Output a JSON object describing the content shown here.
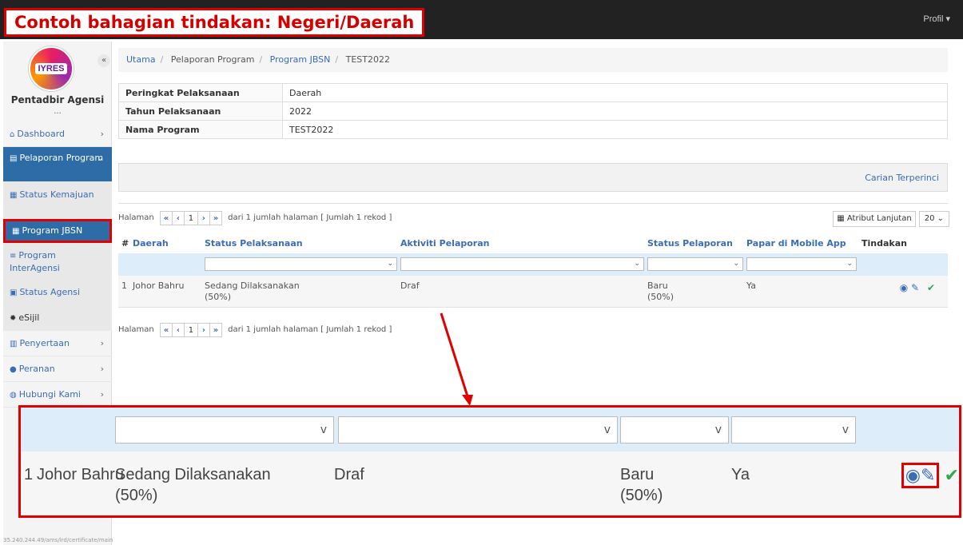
{
  "callout": {
    "title": "Contoh bahagian tindakan: Negeri/Daerah"
  },
  "topbar": {
    "profile_label": "Profil ▾"
  },
  "sidebar": {
    "logo_text": "IYRES",
    "collapse": "«",
    "agency_name": "Pentadbir Agensi",
    "agency_sub": "...",
    "items": [
      {
        "label": "Dashboard",
        "icon": "home-icon"
      },
      {
        "label": "Pelaporan Program",
        "icon": "doc-icon"
      },
      {
        "label": "Status Kemajuan",
        "icon": "table-icon"
      },
      {
        "label": "Program JBSN",
        "icon": "table-icon"
      },
      {
        "label": "Program InterAgensi",
        "icon": "list-icon"
      },
      {
        "label": "Status Agensi",
        "icon": "id-card-icon"
      },
      {
        "label": "eSijil",
        "icon": "badge-icon"
      },
      {
        "label": "Penyertaan",
        "icon": "clipboard-icon"
      },
      {
        "label": "Peranan",
        "icon": "user-icon"
      },
      {
        "label": "Hubungi Kami",
        "icon": "chat-icon"
      }
    ]
  },
  "breadcrumb": [
    "Utama",
    "Pelaporan Program",
    "Program JBSN",
    "TEST2022"
  ],
  "info": [
    {
      "key": "Peringkat Pelaksanaan",
      "value": "Daerah"
    },
    {
      "key": "Tahun Pelaksanaan",
      "value": "2022"
    },
    {
      "key": "Nama Program",
      "value": "TEST2022"
    }
  ],
  "search": {
    "advanced_link": "Carian Terperinci"
  },
  "pager": {
    "label": "Halaman",
    "first": "«",
    "prev": "‹",
    "page": "1",
    "next": "›",
    "last": "»",
    "summary": "dari 1 jumlah halaman [ Jumlah 1 rekod ]"
  },
  "advanced_attr": {
    "label": "Atribut Lanjutan",
    "page_size": "20 ⌄"
  },
  "grid": {
    "headers": [
      "#",
      "Daerah",
      "Status Pelaksanaan",
      "Aktiviti Pelaporan",
      "Status Pelaporan",
      "Papar di Mobile App",
      "Tindakan"
    ],
    "filter_caret": "⌄",
    "row": {
      "num": "1",
      "daerah": "Johor Bahru",
      "status_pelaksanaan": "Sedang Dilaksanakan",
      "status_pelaksanaan_pct": "(50%)",
      "aktiviti": "Draf",
      "status_pelaporan": "Baru",
      "status_pelaporan_pct": "(50%)",
      "papar": "Ya",
      "actions": {
        "view": "◉",
        "edit": "✎",
        "approve": "✔"
      }
    }
  },
  "zoom": {
    "filter_caret": "v",
    "num": "1",
    "daerah": "Johor Bahru",
    "status_pelaksanaan": "Sedang Dilaksanakan",
    "status_pelaksanaan_pct": "(50%)",
    "aktiviti": "Draf",
    "status_pelaporan": "Baru",
    "status_pelaporan_pct": "(50%)",
    "papar": "Ya"
  },
  "status_url": "35.240.244.49/ams/ird/certificate/main"
}
